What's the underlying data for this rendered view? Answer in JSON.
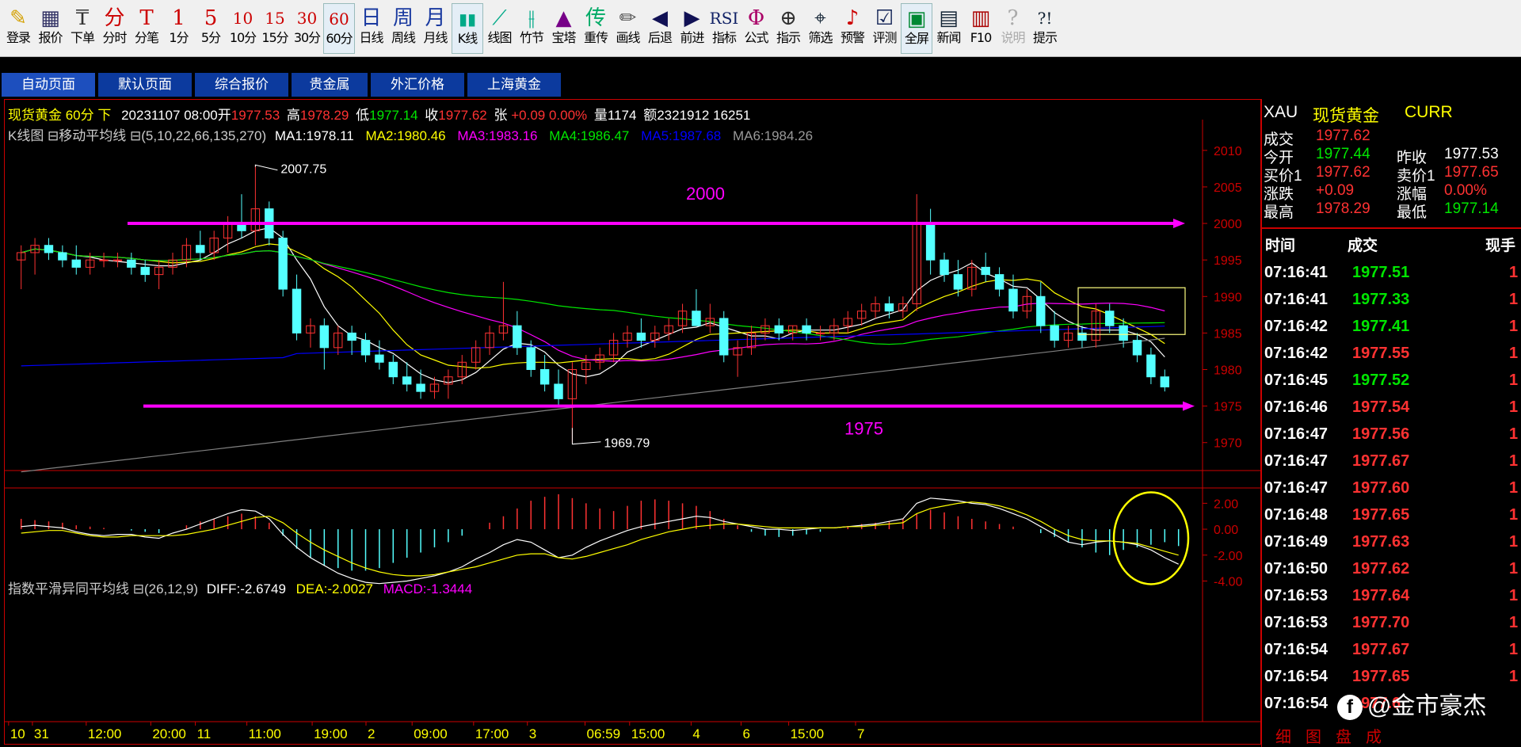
{
  "toolbar": {
    "items": [
      {
        "label": "登录",
        "glyph": "✎",
        "color": "#d4a000"
      },
      {
        "label": "报价",
        "glyph": "▦",
        "color": "#336"
      },
      {
        "label": "下单",
        "glyph": "₸",
        "color": "#333"
      },
      {
        "label": "分时",
        "glyph": "分",
        "color": "#c00"
      },
      {
        "label": "分笔",
        "glyph": "T",
        "color": "#c00"
      },
      {
        "label": "1分",
        "glyph": "1",
        "color": "#c00"
      },
      {
        "label": "5分",
        "glyph": "5",
        "color": "#c00"
      },
      {
        "label": "10分",
        "glyph": "10",
        "color": "#c00"
      },
      {
        "label": "15分",
        "glyph": "15",
        "color": "#c00"
      },
      {
        "label": "30分",
        "glyph": "30",
        "color": "#c00"
      },
      {
        "label": "60分",
        "glyph": "60",
        "color": "#c00"
      },
      {
        "label": "日线",
        "glyph": "日",
        "color": "#1a3aa0"
      },
      {
        "label": "周线",
        "glyph": "周",
        "color": "#1a3aa0"
      },
      {
        "label": "月线",
        "glyph": "月",
        "color": "#1a3aa0"
      },
      {
        "label": "K线",
        "glyph": "▮▮",
        "color": "#0a8"
      },
      {
        "label": "线图",
        "glyph": "⟋",
        "color": "#0a8"
      },
      {
        "label": "竹节",
        "glyph": "⫲",
        "color": "#0a8"
      },
      {
        "label": "宝塔",
        "glyph": "▲",
        "color": "#708"
      },
      {
        "label": "重传",
        "glyph": "传",
        "color": "#0a6"
      },
      {
        "label": "画线",
        "glyph": "✏",
        "color": "#555"
      },
      {
        "label": "后退",
        "glyph": "◀",
        "color": "#115"
      },
      {
        "label": "前进",
        "glyph": "▶",
        "color": "#115"
      },
      {
        "label": "指标",
        "glyph": "RSI",
        "color": "#126"
      },
      {
        "label": "公式",
        "glyph": "Φ",
        "color": "#a06"
      },
      {
        "label": "指示",
        "glyph": "⊕",
        "color": "#333"
      },
      {
        "label": "筛选",
        "glyph": "⌖",
        "color": "#123"
      },
      {
        "label": "预警",
        "glyph": "♪",
        "color": "#c00"
      },
      {
        "label": "评测",
        "glyph": "☑",
        "color": "#125"
      },
      {
        "label": "全屏",
        "glyph": "▣",
        "color": "#083"
      },
      {
        "label": "新闻",
        "glyph": "▤",
        "color": "#123"
      },
      {
        "label": "F10",
        "glyph": "▥",
        "color": "#a00"
      },
      {
        "label": "说明",
        "glyph": "?",
        "color": "#aaa"
      },
      {
        "label": "提示",
        "glyph": "?!",
        "color": "#123"
      }
    ]
  },
  "tabs": [
    "自动页面",
    "默认页面",
    "综合报价",
    "贵金属",
    "外汇价格",
    "上海黄金"
  ],
  "header": {
    "name": "现货黄金 60分 下",
    "date": "20231107 08:00",
    "open_lbl": "开",
    "open": "1977.53",
    "high_lbl": "高",
    "high": "1978.29",
    "low_lbl": "低",
    "low": "1977.14",
    "close_lbl": "收",
    "close": "1977.62",
    "change_lbl": "张",
    "change": "+0.09 0.00%",
    "vol": "量1174",
    "amt": "额2321912 16251"
  },
  "ma_line": {
    "prefix": "K线图 ⊟移动平均线 ⊟(5,10,22,66,135,270)",
    "ma1": "MA1:1978.11",
    "ma2": "MA2:1980.46",
    "ma3": "MA3:1983.16",
    "ma4": "MA4:1986.47",
    "ma5": "MA5:1987.68",
    "ma6": "MA6:1984.26"
  },
  "macd_line": {
    "prefix": "指数平滑异同平均线 ⊟(26,12,9)",
    "diff": "DIFF:-2.6749",
    "dea": "DEA:-2.0027",
    "macd": "MACD:-1.3444"
  },
  "annotations": {
    "high_label": "2007.75",
    "low_label": "1969.79",
    "line_2000": "2000",
    "line_1975": "1975"
  },
  "price_axis": [
    "2010",
    "2005",
    "2000",
    "1995",
    "1990",
    "1985",
    "1980",
    "1975",
    "1970"
  ],
  "macd_axis": [
    "2.00",
    "0.00",
    "-2.00",
    "-4.00"
  ],
  "time_axis": [
    "10",
    "31",
    "12:00",
    "20:00",
    "11",
    "11:00",
    "19:00",
    "2",
    "09:00",
    "17:00",
    "3",
    "06:59",
    "15:00",
    "4",
    "6",
    "15:00",
    "7"
  ],
  "colors": {
    "up": "#ff3232",
    "down": "#54ffff",
    "ma1": "#ffffff",
    "ma2": "#ffff00",
    "ma3": "#ff00ff",
    "ma4": "#00e600",
    "ma5": "#0000ff",
    "ma6": "#808080",
    "annot": "#ff00ff",
    "box": "#ffff80"
  },
  "quote": {
    "symbol": "XAU",
    "name": "现货黄金",
    "type": "CURR",
    "rows": [
      {
        "l1": "成交",
        "v1": "1977.62",
        "c1": "#ff3232"
      },
      {
        "l1": "今开",
        "v1": "1977.44",
        "c1": "#00e600",
        "l2": "昨收",
        "v2": "1977.53",
        "c2": "#ffffff"
      },
      {
        "l1": "买价1",
        "v1": "1977.62",
        "c1": "#ff3232",
        "l2": "卖价1",
        "v2": "1977.65",
        "c2": "#ff3232"
      },
      {
        "l1": "涨跌",
        "v1": "+0.09",
        "c1": "#ff3232",
        "l2": "涨幅",
        "v2": "0.00%",
        "c2": "#ff3232"
      },
      {
        "l1": "最高",
        "v1": "1978.29",
        "c1": "#ff3232",
        "l2": "最低",
        "v2": "1977.14",
        "c2": "#00e600"
      }
    ],
    "tick_header": {
      "time": "时间",
      "price": "成交",
      "hand": "现手"
    },
    "ticks": [
      {
        "t": "07:16:41",
        "p": "1977.51",
        "c": "#00e600",
        "h": "1"
      },
      {
        "t": "07:16:41",
        "p": "1977.33",
        "c": "#00e600",
        "h": "1"
      },
      {
        "t": "07:16:42",
        "p": "1977.41",
        "c": "#00e600",
        "h": "1"
      },
      {
        "t": "07:16:42",
        "p": "1977.55",
        "c": "#ff3232",
        "h": "1"
      },
      {
        "t": "07:16:45",
        "p": "1977.52",
        "c": "#00e600",
        "h": "1"
      },
      {
        "t": "07:16:46",
        "p": "1977.54",
        "c": "#ff3232",
        "h": "1"
      },
      {
        "t": "07:16:47",
        "p": "1977.56",
        "c": "#ff3232",
        "h": "1"
      },
      {
        "t": "07:16:47",
        "p": "1977.67",
        "c": "#ff3232",
        "h": "1"
      },
      {
        "t": "07:16:47",
        "p": "1977.60",
        "c": "#ff3232",
        "h": "1"
      },
      {
        "t": "07:16:48",
        "p": "1977.65",
        "c": "#ff3232",
        "h": "1"
      },
      {
        "t": "07:16:49",
        "p": "1977.63",
        "c": "#ff3232",
        "h": "1"
      },
      {
        "t": "07:16:50",
        "p": "1977.62",
        "c": "#ff3232",
        "h": "1"
      },
      {
        "t": "07:16:53",
        "p": "1977.64",
        "c": "#ff3232",
        "h": "1"
      },
      {
        "t": "07:16:53",
        "p": "1977.70",
        "c": "#ff3232",
        "h": "1"
      },
      {
        "t": "07:16:54",
        "p": "1977.67",
        "c": "#ff3232",
        "h": "1"
      },
      {
        "t": "07:16:54",
        "p": "1977.65",
        "c": "#ff3232",
        "h": "1"
      },
      {
        "t": "07:16:54",
        "p": "1977.6",
        "c": "#ff3232",
        "h": ""
      }
    ],
    "bottom_tabs": [
      "细",
      "图",
      "盘",
      "成"
    ]
  },
  "watermark": "@金市豪杰",
  "chart_data": {
    "type": "candlestick",
    "timeframe": "60分",
    "ylim": [
      1966.5,
      2011.5
    ],
    "macd_ylim": [
      -4.4,
      3.0
    ],
    "ohlc": [
      [
        1995,
        1997,
        1991,
        1996
      ],
      [
        1996,
        1998,
        1993,
        1997
      ],
      [
        1997,
        1998,
        1995,
        1996
      ],
      [
        1996,
        1997,
        1994,
        1995
      ],
      [
        1995,
        1997,
        1993,
        1994
      ],
      [
        1994,
        1996,
        1993,
        1995
      ],
      [
        1995,
        1996,
        1994,
        1995
      ],
      [
        1995,
        1996,
        1994,
        1995
      ],
      [
        1995,
        1996,
        1993,
        1994
      ],
      [
        1994,
        1995,
        1992,
        1993
      ],
      [
        1993,
        1995,
        1991,
        1994
      ],
      [
        1994,
        1996,
        1993,
        1995
      ],
      [
        1995,
        1998,
        1994,
        1997
      ],
      [
        1997,
        1999,
        1995,
        1996
      ],
      [
        1996,
        1999,
        1995,
        1998
      ],
      [
        1998,
        2001,
        1996,
        2000
      ],
      [
        2000,
        2004,
        1998,
        1999
      ],
      [
        1999,
        2008,
        1997,
        2002
      ],
      [
        2002,
        2003,
        1997,
        1998
      ],
      [
        1998,
        1999,
        1990,
        1991
      ],
      [
        1991,
        1993,
        1984,
        1985
      ],
      [
        1985,
        1987,
        1983,
        1986
      ],
      [
        1986,
        1987,
        1980,
        1983
      ],
      [
        1983,
        1986,
        1982,
        1985
      ],
      [
        1985,
        1986,
        1982,
        1984
      ],
      [
        1984,
        1985,
        1981,
        1982
      ],
      [
        1982,
        1984,
        1980,
        1981
      ],
      [
        1981,
        1982,
        1978,
        1979
      ],
      [
        1979,
        1981,
        1977,
        1978
      ],
      [
        1978,
        1980,
        1976,
        1977
      ],
      [
        1977,
        1979,
        1976,
        1978
      ],
      [
        1978,
        1980,
        1976,
        1979
      ],
      [
        1979,
        1982,
        1978,
        1981
      ],
      [
        1981,
        1984,
        1980,
        1983
      ],
      [
        1983,
        1986,
        1982,
        1985
      ],
      [
        1985,
        1992,
        1984,
        1986
      ],
      [
        1986,
        1988,
        1982,
        1983
      ],
      [
        1983,
        1984,
        1979,
        1980
      ],
      [
        1980,
        1982,
        1977,
        1978
      ],
      [
        1978,
        1980,
        1975,
        1976
      ],
      [
        1976,
        1981,
        1970,
        1980
      ],
      [
        1980,
        1982,
        1978,
        1981
      ],
      [
        1981,
        1983,
        1980,
        1982
      ],
      [
        1982,
        1985,
        1981,
        1984
      ],
      [
        1984,
        1986,
        1983,
        1985
      ],
      [
        1985,
        1987,
        1983,
        1984
      ],
      [
        1984,
        1986,
        1983,
        1985
      ],
      [
        1985,
        1987,
        1984,
        1986
      ],
      [
        1986,
        1989,
        1985,
        1988
      ],
      [
        1988,
        1991,
        1987,
        1986
      ],
      [
        1986,
        1989,
        1985,
        1987
      ],
      [
        1987,
        1988,
        1981,
        1982
      ],
      [
        1982,
        1984,
        1979,
        1983
      ],
      [
        1983,
        1986,
        1982,
        1985
      ],
      [
        1985,
        1987,
        1984,
        1986
      ],
      [
        1986,
        1987,
        1984,
        1985
      ],
      [
        1985,
        1986,
        1984,
        1986
      ],
      [
        1986,
        1987,
        1984,
        1985
      ],
      [
        1985,
        1986,
        1984,
        1985
      ],
      [
        1985,
        1987,
        1984,
        1986
      ],
      [
        1986,
        1988,
        1985,
        1987
      ],
      [
        1987,
        1989,
        1986,
        1988
      ],
      [
        1988,
        1990,
        1987,
        1989
      ],
      [
        1989,
        1990,
        1987,
        1988
      ],
      [
        1988,
        1990,
        1987,
        1989
      ],
      [
        1989,
        2004,
        1988,
        2000
      ],
      [
        2000,
        2002,
        1993,
        1995
      ],
      [
        1995,
        1996,
        1992,
        1993
      ],
      [
        1993,
        1995,
        1990,
        1991
      ],
      [
        1991,
        1995,
        1990,
        1994
      ],
      [
        1994,
        1996,
        1992,
        1993
      ],
      [
        1993,
        1994,
        1990,
        1991
      ],
      [
        1991,
        1993,
        1987,
        1988
      ],
      [
        1988,
        1991,
        1987,
        1990
      ],
      [
        1990,
        1992,
        1985,
        1986
      ],
      [
        1986,
        1988,
        1983,
        1984
      ],
      [
        1984,
        1986,
        1983,
        1985
      ],
      [
        1985,
        1986,
        1983,
        1984
      ],
      [
        1984,
        1989,
        1983,
        1988
      ],
      [
        1988,
        1989,
        1985,
        1986
      ],
      [
        1986,
        1987,
        1983,
        1984
      ],
      [
        1984,
        1985,
        1981,
        1982
      ],
      [
        1982,
        1983,
        1978,
        1979
      ],
      [
        1979,
        1980,
        1977,
        1977.62
      ]
    ],
    "ma_series": [
      "MA1",
      "MA2",
      "MA3",
      "MA4",
      "MA5",
      "MA6"
    ],
    "macd_hist": [
      0.8,
      0.7,
      0.6,
      0.5,
      0.3,
      0.2,
      0.1,
      0.0,
      -0.1,
      -0.2,
      -0.3,
      0.0,
      0.3,
      0.6,
      0.8,
      1.0,
      1.2,
      1.0,
      0.5,
      -0.5,
      -1.5,
      -2.2,
      -2.8,
      -3.0,
      -3.2,
      -3.2,
      -3.0,
      -2.6,
      -2.2,
      -1.8,
      -1.4,
      -1.0,
      -0.5,
      0.0,
      0.5,
      1.0,
      1.6,
      2.2,
      2.5,
      2.7,
      2.4,
      2.0,
      1.6,
      1.4,
      1.8,
      2.2,
      2.3,
      2.2,
      2.0,
      1.8,
      1.4,
      0.8,
      0.3,
      -0.2,
      -0.5,
      -0.6,
      -0.5,
      -0.4,
      -0.2,
      0.0,
      0.2,
      0.4,
      0.5,
      0.6,
      0.8,
      1.2,
      1.5,
      1.3,
      1.0,
      0.8,
      0.6,
      0.4,
      0.2,
      0.0,
      -0.3,
      -0.6,
      -1.0,
      -1.4,
      -1.8,
      -2.0,
      -1.6,
      -1.4,
      -1.2,
      -1.0,
      -1.3
    ],
    "diff": [
      0.2,
      0.3,
      0.2,
      0.1,
      -0.2,
      -0.4,
      -0.5,
      -0.4,
      -0.4,
      -0.6,
      -0.7,
      -0.3,
      0.0,
      0.4,
      0.8,
      1.2,
      1.5,
      1.4,
      0.8,
      -0.4,
      -1.4,
      -2.2,
      -2.8,
      -3.4,
      -3.8,
      -4.1,
      -4.2,
      -4.1,
      -4.0,
      -3.8,
      -3.6,
      -3.3,
      -2.9,
      -2.3,
      -1.8,
      -1.2,
      -0.8,
      -1.0,
      -1.6,
      -2.2,
      -2.0,
      -1.4,
      -0.9,
      -0.5,
      -0.1,
      0.2,
      0.4,
      0.6,
      0.8,
      1.0,
      0.9,
      0.6,
      0.4,
      0.2,
      0.0,
      0.0,
      -0.1,
      0.0,
      0.1,
      0.1,
      0.2,
      0.3,
      0.4,
      0.6,
      0.8,
      2.0,
      2.4,
      2.3,
      2.2,
      2.0,
      1.9,
      1.6,
      1.2,
      0.8,
      0.2,
      -0.4,
      -1.0,
      -1.2,
      -1.0,
      -0.9,
      -1.0,
      -1.2,
      -1.6,
      -2.2,
      -2.7
    ],
    "dea": [
      -0.3,
      -0.2,
      -0.1,
      -0.1,
      -0.3,
      -0.5,
      -0.6,
      -0.6,
      -0.5,
      -0.5,
      -0.5,
      -0.5,
      -0.4,
      -0.2,
      0.0,
      0.3,
      0.6,
      0.9,
      1.0,
      0.5,
      -0.3,
      -1.0,
      -1.6,
      -2.1,
      -2.6,
      -3.0,
      -3.3,
      -3.5,
      -3.6,
      -3.6,
      -3.5,
      -3.3,
      -3.1,
      -2.9,
      -2.6,
      -2.3,
      -2.0,
      -1.9,
      -1.9,
      -2.2,
      -2.3,
      -2.1,
      -1.8,
      -1.5,
      -1.2,
      -0.8,
      -0.5,
      -0.2,
      0.0,
      0.2,
      0.3,
      0.4,
      0.4,
      0.3,
      0.2,
      0.1,
      0.1,
      0.1,
      0.1,
      0.1,
      0.2,
      0.2,
      0.3,
      0.4,
      0.5,
      1.2,
      1.6,
      1.8,
      2.0,
      2.1,
      2.0,
      1.8,
      1.5,
      1.1,
      0.6,
      0.0,
      -0.5,
      -0.8,
      -0.9,
      -0.9,
      -1.0,
      -1.1,
      -1.4,
      -1.7,
      -2.0
    ]
  }
}
